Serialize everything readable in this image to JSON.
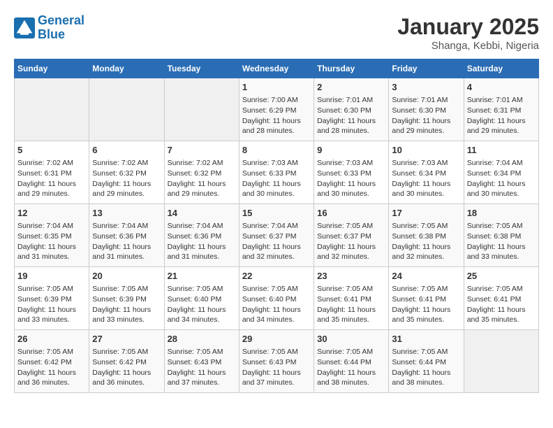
{
  "header": {
    "logo_line1": "General",
    "logo_line2": "Blue",
    "month": "January 2025",
    "location": "Shanga, Kebbi, Nigeria"
  },
  "weekdays": [
    "Sunday",
    "Monday",
    "Tuesday",
    "Wednesday",
    "Thursday",
    "Friday",
    "Saturday"
  ],
  "weeks": [
    [
      {
        "day": "",
        "empty": true
      },
      {
        "day": "",
        "empty": true
      },
      {
        "day": "",
        "empty": true
      },
      {
        "day": "1",
        "sunrise": "Sunrise: 7:00 AM",
        "sunset": "Sunset: 6:29 PM",
        "daylight": "Daylight: 11 hours and 28 minutes."
      },
      {
        "day": "2",
        "sunrise": "Sunrise: 7:01 AM",
        "sunset": "Sunset: 6:30 PM",
        "daylight": "Daylight: 11 hours and 28 minutes."
      },
      {
        "day": "3",
        "sunrise": "Sunrise: 7:01 AM",
        "sunset": "Sunset: 6:30 PM",
        "daylight": "Daylight: 11 hours and 29 minutes."
      },
      {
        "day": "4",
        "sunrise": "Sunrise: 7:01 AM",
        "sunset": "Sunset: 6:31 PM",
        "daylight": "Daylight: 11 hours and 29 minutes."
      }
    ],
    [
      {
        "day": "5",
        "sunrise": "Sunrise: 7:02 AM",
        "sunset": "Sunset: 6:31 PM",
        "daylight": "Daylight: 11 hours and 29 minutes."
      },
      {
        "day": "6",
        "sunrise": "Sunrise: 7:02 AM",
        "sunset": "Sunset: 6:32 PM",
        "daylight": "Daylight: 11 hours and 29 minutes."
      },
      {
        "day": "7",
        "sunrise": "Sunrise: 7:02 AM",
        "sunset": "Sunset: 6:32 PM",
        "daylight": "Daylight: 11 hours and 29 minutes."
      },
      {
        "day": "8",
        "sunrise": "Sunrise: 7:03 AM",
        "sunset": "Sunset: 6:33 PM",
        "daylight": "Daylight: 11 hours and 30 minutes."
      },
      {
        "day": "9",
        "sunrise": "Sunrise: 7:03 AM",
        "sunset": "Sunset: 6:33 PM",
        "daylight": "Daylight: 11 hours and 30 minutes."
      },
      {
        "day": "10",
        "sunrise": "Sunrise: 7:03 AM",
        "sunset": "Sunset: 6:34 PM",
        "daylight": "Daylight: 11 hours and 30 minutes."
      },
      {
        "day": "11",
        "sunrise": "Sunrise: 7:04 AM",
        "sunset": "Sunset: 6:34 PM",
        "daylight": "Daylight: 11 hours and 30 minutes."
      }
    ],
    [
      {
        "day": "12",
        "sunrise": "Sunrise: 7:04 AM",
        "sunset": "Sunset: 6:35 PM",
        "daylight": "Daylight: 11 hours and 31 minutes."
      },
      {
        "day": "13",
        "sunrise": "Sunrise: 7:04 AM",
        "sunset": "Sunset: 6:36 PM",
        "daylight": "Daylight: 11 hours and 31 minutes."
      },
      {
        "day": "14",
        "sunrise": "Sunrise: 7:04 AM",
        "sunset": "Sunset: 6:36 PM",
        "daylight": "Daylight: 11 hours and 31 minutes."
      },
      {
        "day": "15",
        "sunrise": "Sunrise: 7:04 AM",
        "sunset": "Sunset: 6:37 PM",
        "daylight": "Daylight: 11 hours and 32 minutes."
      },
      {
        "day": "16",
        "sunrise": "Sunrise: 7:05 AM",
        "sunset": "Sunset: 6:37 PM",
        "daylight": "Daylight: 11 hours and 32 minutes."
      },
      {
        "day": "17",
        "sunrise": "Sunrise: 7:05 AM",
        "sunset": "Sunset: 6:38 PM",
        "daylight": "Daylight: 11 hours and 32 minutes."
      },
      {
        "day": "18",
        "sunrise": "Sunrise: 7:05 AM",
        "sunset": "Sunset: 6:38 PM",
        "daylight": "Daylight: 11 hours and 33 minutes."
      }
    ],
    [
      {
        "day": "19",
        "sunrise": "Sunrise: 7:05 AM",
        "sunset": "Sunset: 6:39 PM",
        "daylight": "Daylight: 11 hours and 33 minutes."
      },
      {
        "day": "20",
        "sunrise": "Sunrise: 7:05 AM",
        "sunset": "Sunset: 6:39 PM",
        "daylight": "Daylight: 11 hours and 33 minutes."
      },
      {
        "day": "21",
        "sunrise": "Sunrise: 7:05 AM",
        "sunset": "Sunset: 6:40 PM",
        "daylight": "Daylight: 11 hours and 34 minutes."
      },
      {
        "day": "22",
        "sunrise": "Sunrise: 7:05 AM",
        "sunset": "Sunset: 6:40 PM",
        "daylight": "Daylight: 11 hours and 34 minutes."
      },
      {
        "day": "23",
        "sunrise": "Sunrise: 7:05 AM",
        "sunset": "Sunset: 6:41 PM",
        "daylight": "Daylight: 11 hours and 35 minutes."
      },
      {
        "day": "24",
        "sunrise": "Sunrise: 7:05 AM",
        "sunset": "Sunset: 6:41 PM",
        "daylight": "Daylight: 11 hours and 35 minutes."
      },
      {
        "day": "25",
        "sunrise": "Sunrise: 7:05 AM",
        "sunset": "Sunset: 6:41 PM",
        "daylight": "Daylight: 11 hours and 35 minutes."
      }
    ],
    [
      {
        "day": "26",
        "sunrise": "Sunrise: 7:05 AM",
        "sunset": "Sunset: 6:42 PM",
        "daylight": "Daylight: 11 hours and 36 minutes."
      },
      {
        "day": "27",
        "sunrise": "Sunrise: 7:05 AM",
        "sunset": "Sunset: 6:42 PM",
        "daylight": "Daylight: 11 hours and 36 minutes."
      },
      {
        "day": "28",
        "sunrise": "Sunrise: 7:05 AM",
        "sunset": "Sunset: 6:43 PM",
        "daylight": "Daylight: 11 hours and 37 minutes."
      },
      {
        "day": "29",
        "sunrise": "Sunrise: 7:05 AM",
        "sunset": "Sunset: 6:43 PM",
        "daylight": "Daylight: 11 hours and 37 minutes."
      },
      {
        "day": "30",
        "sunrise": "Sunrise: 7:05 AM",
        "sunset": "Sunset: 6:44 PM",
        "daylight": "Daylight: 11 hours and 38 minutes."
      },
      {
        "day": "31",
        "sunrise": "Sunrise: 7:05 AM",
        "sunset": "Sunset: 6:44 PM",
        "daylight": "Daylight: 11 hours and 38 minutes."
      },
      {
        "day": "",
        "empty": true
      }
    ]
  ]
}
